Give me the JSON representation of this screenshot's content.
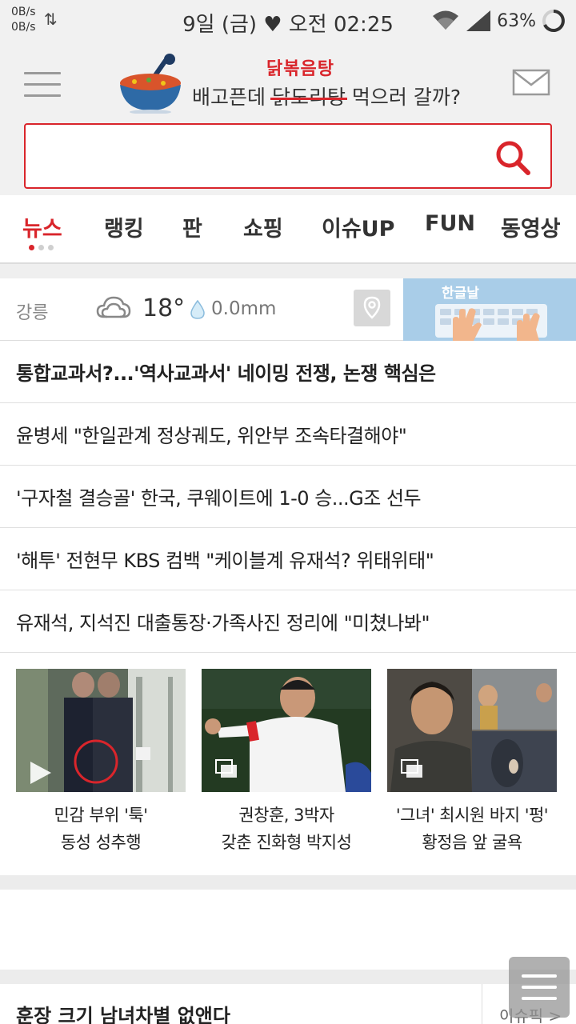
{
  "status_bar": {
    "net_speed_up": "0B/s",
    "net_speed_down": "0B/s",
    "time": "9일 (금) ♥ 오전 02:25",
    "battery": "63%"
  },
  "header": {
    "promo_highlight": "닭볶음탕",
    "promo_prefix": "배고픈데 ",
    "promo_struck": "닭도리탕",
    "promo_suffix": " 먹으러 갈까?",
    "search": {
      "value": "",
      "placeholder": ""
    }
  },
  "tabs": [
    {
      "label": "뉴스",
      "active": true
    },
    {
      "label": "랭킹"
    },
    {
      "label": "판"
    },
    {
      "label": "쇼핑"
    },
    {
      "label": "이슈UP"
    },
    {
      "label": "FUN"
    },
    {
      "label": "동영상"
    }
  ],
  "weather": {
    "city": "강릉",
    "temp": "18°",
    "rain": "0.0mm",
    "banner_text": "한글날"
  },
  "headlines": [
    "통합교과서?...'역사교과서' 네이밍 전쟁, 논쟁 핵심은",
    "윤병세 \"한일관계 정상궤도, 위안부 조속타결해야\"",
    "'구자철 결승골' 한국, 쿠웨이트에 1-0 승...G조 선두",
    "'해투' 전현무 KBS 컴백 \"케이블계 유재석? 위태위태\"",
    "유재석, 지석진 대출통장·가족사진 정리에 \"미쳤나봐\""
  ],
  "photo_cards": [
    {
      "line1": "민감 부위 '툭'",
      "line2": "동성 성추행",
      "media": "video"
    },
    {
      "line1": "권창훈, 3박자",
      "line2": "갖춘 진화형 박지성",
      "media": "gallery"
    },
    {
      "line1": "'그녀' 최시원 바지 '펑'",
      "line2": "황정음 앞 굴욕",
      "media": "gallery"
    }
  ],
  "bottom": {
    "headline": "훈장 크기 남녀차별 없앤다",
    "issue_pick": "이슈픽 >"
  },
  "colors": {
    "accent": "#d9252b",
    "header_bg": "#f1f1f1",
    "banner_bg": "#a9cde8"
  }
}
